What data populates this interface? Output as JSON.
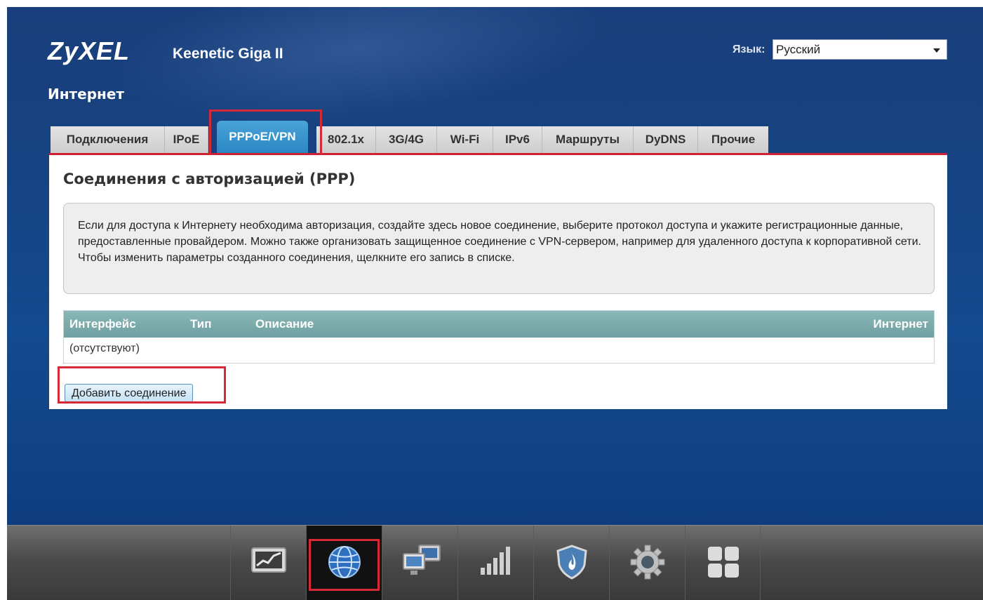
{
  "brand": {
    "logo": "ZyXEL",
    "model": "Keenetic Giga II"
  },
  "header": {
    "page_title": "Интернет",
    "language_label": "Язык:",
    "language_value": "Русский"
  },
  "tabs": [
    {
      "label": "Подключения",
      "active": false
    },
    {
      "label": "IPoE",
      "active": false
    },
    {
      "label": "PPPoE/VPN",
      "active": true
    },
    {
      "label": "802.1x",
      "active": false
    },
    {
      "label": "3G/4G",
      "active": false
    },
    {
      "label": "Wi-Fi",
      "active": false
    },
    {
      "label": "IPv6",
      "active": false
    },
    {
      "label": "Маршруты",
      "active": false
    },
    {
      "label": "DyDNS",
      "active": false
    },
    {
      "label": "Прочие",
      "active": false
    }
  ],
  "panel": {
    "title": "Соединения с авторизацией (PPP)",
    "info": "Если для доступа к Интернету необходима авторизация, создайте здесь новое соединение, выберите протокол доступа и укажите регистрационные данные, предоставленные провайдером. Можно также организовать защищенное соединение с VPN-сервером, например для удаленного доступа к корпоративной сети. Чтобы изменить параметры созданного соединения, щелкните его запись в списке.",
    "table": {
      "columns": [
        "Интерфейс",
        "Тип",
        "Описание",
        "Интернет"
      ],
      "empty_text": "(отсутствуют)"
    },
    "add_button": "Добавить соединение"
  },
  "dock": [
    {
      "icon": "monitor-chart-icon",
      "active": false
    },
    {
      "icon": "globe-icon",
      "active": true
    },
    {
      "icon": "network-computers-icon",
      "active": false
    },
    {
      "icon": "signal-bars-icon",
      "active": false
    },
    {
      "icon": "shield-icon",
      "active": false
    },
    {
      "icon": "gear-icon",
      "active": false
    },
    {
      "icon": "apps-grid-icon",
      "active": false
    }
  ],
  "colors": {
    "accent_tab": "#2b87c4",
    "highlight": "#d52a35",
    "table_header": "#7aa9aa"
  }
}
